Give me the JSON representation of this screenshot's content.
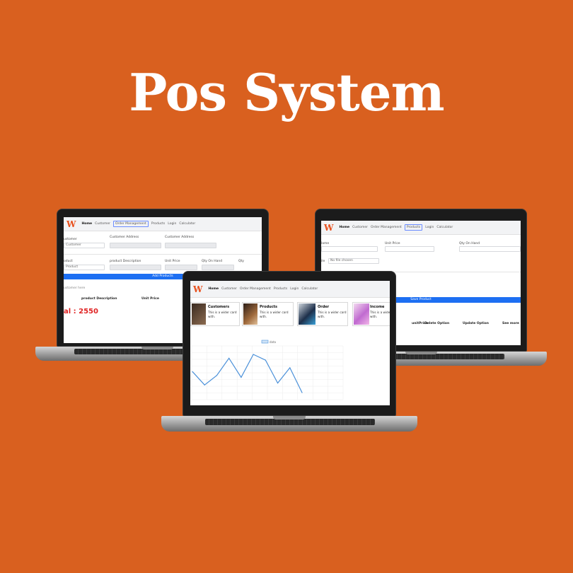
{
  "title": "Pos System",
  "brand_color": "#d9601f",
  "accent_blue": "#1d6ff2",
  "logo_text": "W",
  "left_screen": {
    "nav": [
      "Home",
      "Customer",
      "Order Management",
      "Products",
      "Login",
      "Calculator"
    ],
    "customer_label": "ustomer",
    "customer_value": "Customer",
    "customer_address_label": "Customer Address",
    "customer_address_label2": "Customer Address",
    "product_label": "oduct",
    "product_value": "Product",
    "product_description_label": "product Description",
    "unit_price_label": "Unit Price",
    "qty_on_hand_label": "Qty On Hand",
    "qty_label": "Qty",
    "add_button": "Add Products",
    "customer_here": "ustomer here",
    "col_description": "product Description",
    "col_unit_price": "Unit Price",
    "total": "al : 2550"
  },
  "right_screen": {
    "nav": [
      "Home",
      "Customer",
      "Order Management",
      "Products",
      "Login",
      "Calculator"
    ],
    "name_label": "lame",
    "unit_price_label": "Unit Price",
    "qty_on_hand_label": "Qty On Hand",
    "file_label": "ile",
    "no_file": "No file chosen",
    "save_button": "Save Product",
    "col_unit_price": "unitPrice",
    "col_delete": "Delete Option",
    "col_update": "Update Option",
    "col_see_more": "See more"
  },
  "center_screen": {
    "nav": [
      "Home",
      "Customer",
      "Order Management",
      "Products",
      "Login",
      "Calculator"
    ],
    "cards": [
      {
        "title": "Customers",
        "desc": "This is a wider card with."
      },
      {
        "title": "Products",
        "desc": "This is a wider card with."
      },
      {
        "title": "Order",
        "desc": "This is a wider card with."
      },
      {
        "title": "Income",
        "desc": "This is a wide with."
      }
    ],
    "legend": "data"
  },
  "chart_data": {
    "type": "line",
    "x": [
      1,
      2,
      3,
      4,
      5,
      6,
      7,
      8,
      9,
      10
    ],
    "values": [
      55,
      20,
      45,
      90,
      40,
      100,
      85,
      25,
      65,
      0
    ],
    "series": [
      {
        "name": "data",
        "color": "#4a90d9"
      }
    ]
  }
}
